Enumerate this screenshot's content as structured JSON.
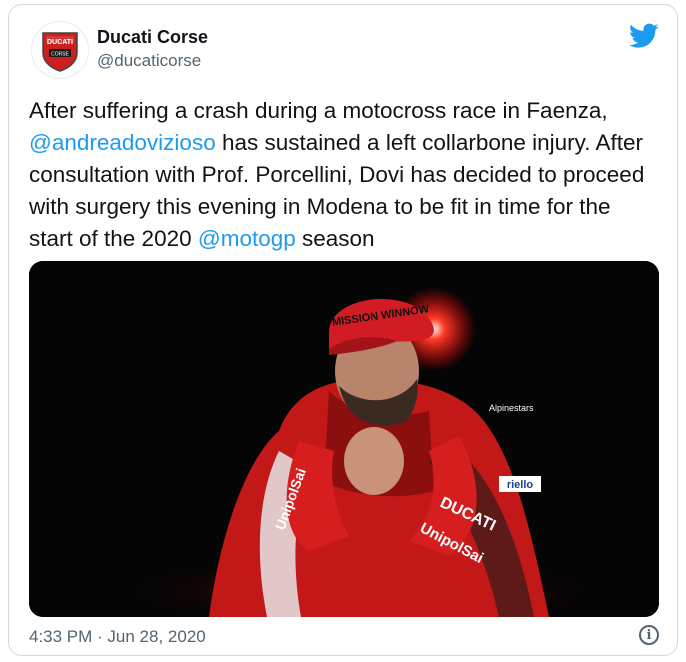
{
  "tweet": {
    "author_name": "Ducati Corse",
    "author_handle": "@ducaticorse",
    "text_parts": [
      "After suffering a crash during a motocross race in Faenza, ",
      "@andreadovizioso",
      " has sustained a left collarbone injury. After consultation with Prof. Porcellini, Dovi has decided to proceed with surgery this evening in Modena to be fit in time for the start of the 2020 ",
      "@motogp",
      " season"
    ],
    "timestamp": "4:33 PM · Jun 28, 2020",
    "info_label": "i"
  },
  "avatar": {
    "logo_text": "DUCATI",
    "logo_subtext": "CORSE"
  },
  "media": {
    "cap_text": "MISSION WINNOW",
    "sponsor_1": "UnipolSai",
    "sponsor_2": "DUCATI",
    "sponsor_3": "riello",
    "sponsor_4": "UnipolSai",
    "sponsor_5": "Alpinestars"
  },
  "colors": {
    "link": "#1d9bf0",
    "muted": "#536471",
    "ducati_red": "#cc1f1f"
  },
  "icons": {
    "platform": "twitter-bird-icon",
    "info": "info-icon"
  }
}
